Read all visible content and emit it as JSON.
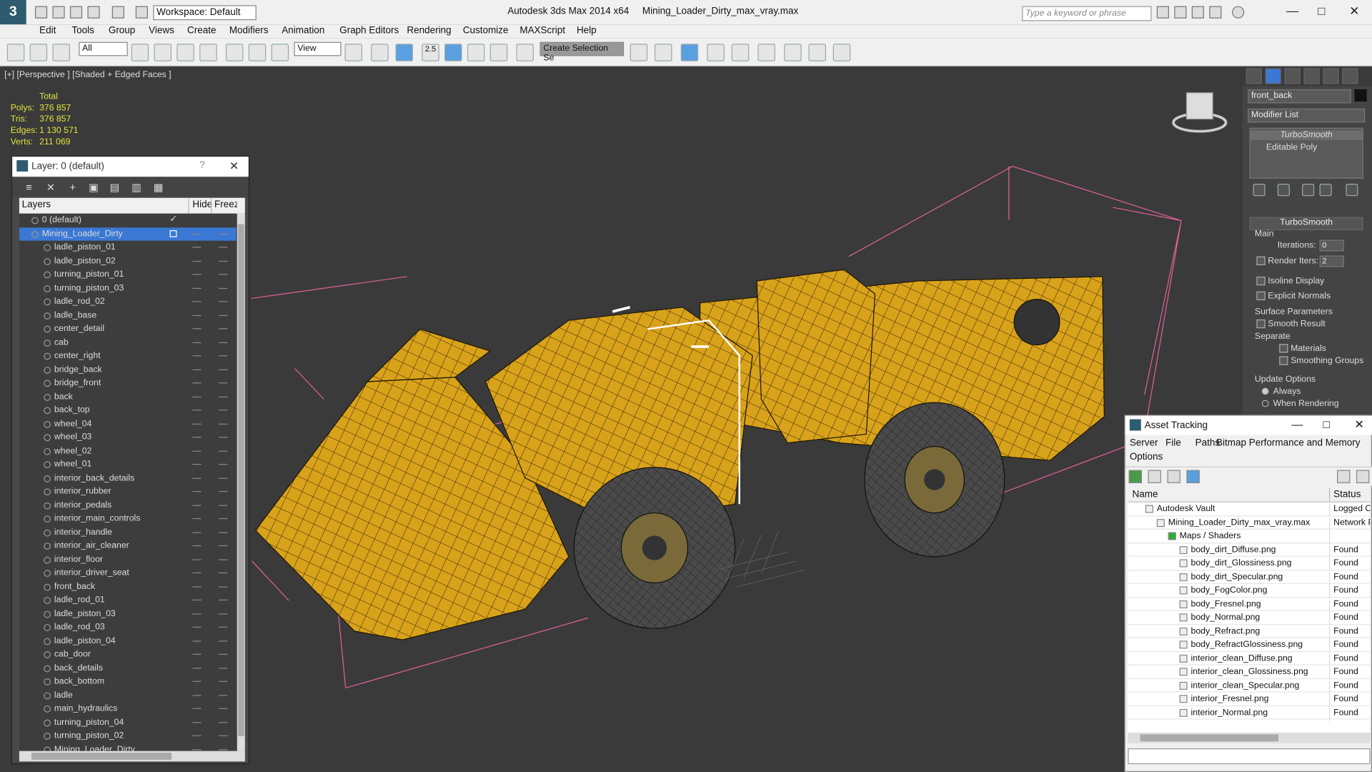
{
  "app": {
    "title": "Autodesk 3ds Max  2014 x64",
    "filename": "Mining_Loader_Dirty_max_vray.max",
    "workspace": "Workspace: Default",
    "search_placeholder": "Type a keyword or phrase",
    "logo": "3"
  },
  "menu": [
    "Edit",
    "Tools",
    "Group",
    "Views",
    "Create",
    "Modifiers",
    "Animation",
    "Graph Editors",
    "Rendering",
    "Customize",
    "MAXScript",
    "Help"
  ],
  "toolbar": {
    "filter": "All",
    "refcoord": "View",
    "snap": "2.5",
    "selset": "Create Selection Se"
  },
  "viewport": {
    "label": "[+] [Perspective ] [Shaded + Edged Faces ]",
    "stats": {
      "header": "Total",
      "rows": [
        {
          "k": "Polys:",
          "v": "376 857"
        },
        {
          "k": "Tris:",
          "v": "376 857"
        },
        {
          "k": "Edges:",
          "v": "1 130 571"
        },
        {
          "k": "Verts:",
          "v": "211 069"
        }
      ]
    }
  },
  "command_panel": {
    "object_name": "front_back",
    "modifier_list": "Modifier List",
    "stack": [
      "TurboSmooth",
      "Editable Poly"
    ],
    "rollout": "TurboSmooth",
    "main": "Main",
    "iterations_label": "Iterations:",
    "iterations": "0",
    "render_iters_label": "Render Iters:",
    "render_iters": "2",
    "isoline": "Isoline Display",
    "explicit": "Explicit Normals",
    "surface": "Surface Parameters",
    "smooth_result": "Smooth Result",
    "separate": "Separate",
    "materials": "Materials",
    "smoothing_groups": "Smoothing Groups",
    "update": "Update Options",
    "always": "Always",
    "when_rendering": "When Rendering"
  },
  "layer_window": {
    "title": "Layer: 0 (default)",
    "col_layers": "Layers",
    "col_hide": "Hide",
    "col_freeze": "Freeze",
    "rows": [
      "0 (default)",
      "Mining_Loader_Dirty",
      "ladle_piston_01",
      "ladle_piston_02",
      "turning_piston_01",
      "turning_piston_03",
      "ladle_rod_02",
      "ladle_base",
      "center_detail",
      "cab",
      "center_right",
      "bridge_back",
      "bridge_front",
      "back",
      "back_top",
      "wheel_04",
      "wheel_03",
      "wheel_02",
      "wheel_01",
      "interior_back_details",
      "interior_rubber",
      "interior_pedals",
      "interior_main_controls",
      "interior_handle",
      "interior_air_cleaner",
      "interior_floor",
      "interior_driver_seat",
      "front_back",
      "ladle_rod_01",
      "ladle_piston_03",
      "ladle_rod_03",
      "ladle_piston_04",
      "cab_door",
      "back_details",
      "back_bottom",
      "ladle",
      "main_hydraulics",
      "turning_piston_04",
      "turning_piston_02",
      "Mining_Loader_Dirty"
    ]
  },
  "asset_window": {
    "title": "Asset Tracking",
    "menu": [
      "Server",
      "File",
      "Paths",
      "Bitmap Performance and Memory",
      "Options"
    ],
    "col_name": "Name",
    "col_status": "Status",
    "rows": [
      {
        "name": "Autodesk Vault",
        "status": "Logged O",
        "indent": 0
      },
      {
        "name": "Mining_Loader_Dirty_max_vray.max",
        "status": "Network P",
        "indent": 1
      },
      {
        "name": "Maps / Shaders",
        "status": "",
        "indent": 2
      },
      {
        "name": "body_dirt_Diffuse.png",
        "status": "Found",
        "indent": 3
      },
      {
        "name": "body_dirt_Glossiness.png",
        "status": "Found",
        "indent": 3
      },
      {
        "name": "body_dirt_Specular.png",
        "status": "Found",
        "indent": 3
      },
      {
        "name": "body_FogColor.png",
        "status": "Found",
        "indent": 3
      },
      {
        "name": "body_Fresnel.png",
        "status": "Found",
        "indent": 3
      },
      {
        "name": "body_Normal.png",
        "status": "Found",
        "indent": 3
      },
      {
        "name": "body_Refract.png",
        "status": "Found",
        "indent": 3
      },
      {
        "name": "body_RefractGlossiness.png",
        "status": "Found",
        "indent": 3
      },
      {
        "name": "interior_clean_Diffuse.png",
        "status": "Found",
        "indent": 3
      },
      {
        "name": "interior_clean_Glossiness.png",
        "status": "Found",
        "indent": 3
      },
      {
        "name": "interior_clean_Specular.png",
        "status": "Found",
        "indent": 3
      },
      {
        "name": "interior_Fresnel.png",
        "status": "Found",
        "indent": 3
      },
      {
        "name": "interior_Normal.png",
        "status": "Found",
        "indent": 3
      }
    ]
  },
  "colors": {
    "viewport_bg": "#3a3a3a",
    "stats": "#dfe33f",
    "loader": "#d9a21b",
    "selection": "#3a78d4",
    "bbox": "#e0609a"
  }
}
